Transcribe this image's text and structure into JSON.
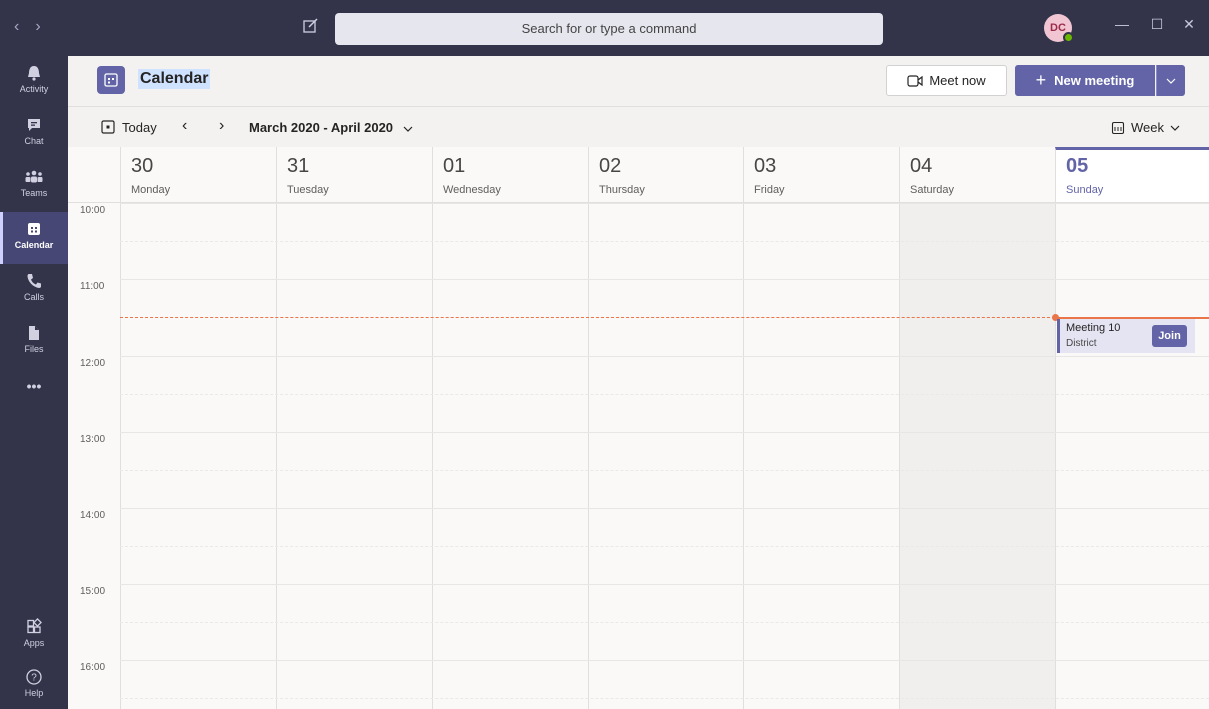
{
  "titlebar": {
    "back_label": "‹",
    "forward_label": "›",
    "search_placeholder": "Search for or type a command",
    "avatar_initials": "DC",
    "minimize_label": "—",
    "maximize_label": "☐",
    "close_label": "✕"
  },
  "rail": {
    "items": [
      {
        "label": "Activity",
        "icon": "bell-icon"
      },
      {
        "label": "Chat",
        "icon": "chat-icon"
      },
      {
        "label": "Teams",
        "icon": "teams-icon"
      },
      {
        "label": "Calendar",
        "icon": "calendar-icon",
        "active": true
      },
      {
        "label": "Calls",
        "icon": "phone-icon"
      },
      {
        "label": "Files",
        "icon": "file-icon"
      },
      {
        "label": "•••",
        "icon": "more-icon"
      }
    ],
    "bottom": [
      {
        "label": "Apps",
        "icon": "apps-icon"
      },
      {
        "label": "Help",
        "icon": "help-icon"
      }
    ]
  },
  "header": {
    "title": "Calendar",
    "meet_now": "Meet now",
    "new_meeting": "New meeting"
  },
  "toolbar": {
    "today": "Today",
    "prev": "‹",
    "next": "›",
    "date_range": "March 2020 - April 2020",
    "view": "Week"
  },
  "days": [
    {
      "num": "30",
      "name": "Monday"
    },
    {
      "num": "31",
      "name": "Tuesday"
    },
    {
      "num": "01",
      "name": "Wednesday"
    },
    {
      "num": "02",
      "name": "Thursday"
    },
    {
      "num": "03",
      "name": "Friday"
    },
    {
      "num": "04",
      "name": "Saturday"
    },
    {
      "num": "05",
      "name": "Sunday"
    }
  ],
  "hours": [
    "10:00",
    "11:00",
    "12:00",
    "13:00",
    "14:00",
    "15:00",
    "16:00"
  ],
  "event": {
    "title": "Meeting 10",
    "location": "District",
    "join": "Join"
  },
  "colors": {
    "accent": "#6264a7",
    "rail_bg": "#33344a",
    "now_line": "#e97548",
    "weekend_shade": "#f0efee"
  }
}
